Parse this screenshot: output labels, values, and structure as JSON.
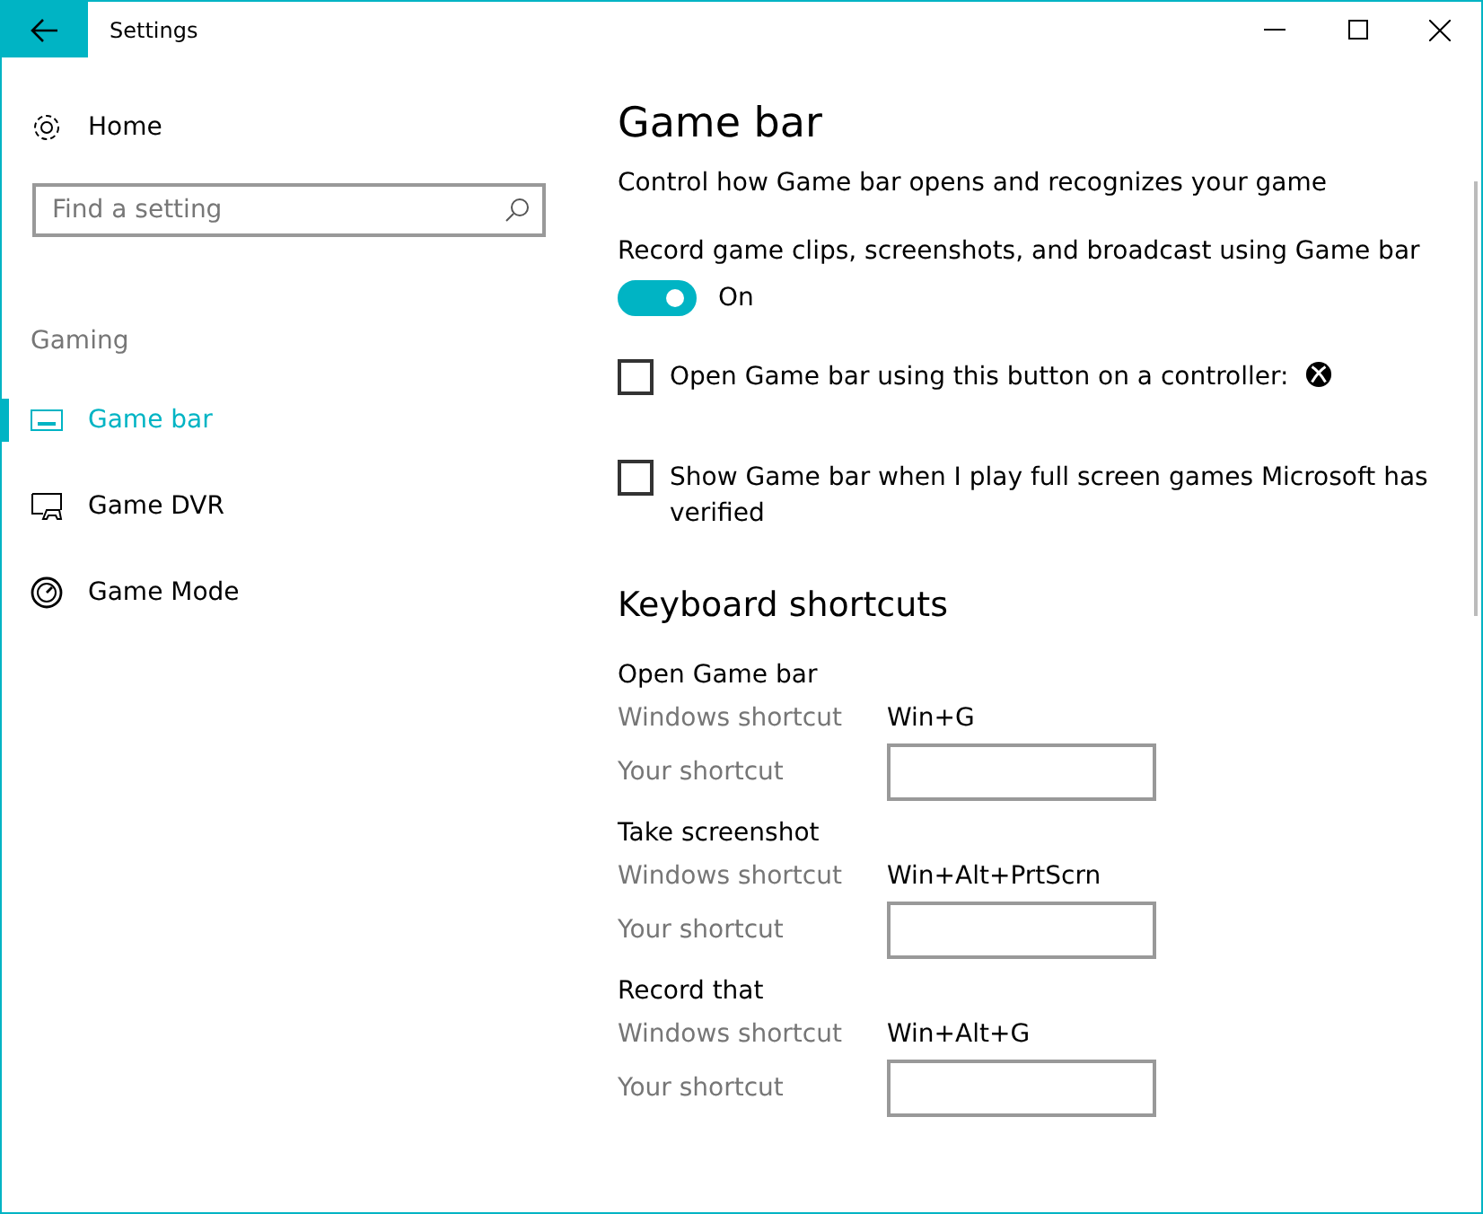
{
  "window": {
    "title": "Settings"
  },
  "sidebar": {
    "home": "Home",
    "search": {
      "placeholder": "Find a setting"
    },
    "section": "Gaming",
    "items": [
      {
        "label": "Game bar",
        "selected": true
      },
      {
        "label": "Game DVR",
        "selected": false
      },
      {
        "label": "Game Mode",
        "selected": false
      }
    ]
  },
  "page": {
    "title": "Game bar",
    "subtitle": "Control how Game bar opens and recognizes your game",
    "toggle": {
      "label": "Record game clips, screenshots, and broadcast using Game bar",
      "on": true,
      "state_text": "On"
    },
    "checkboxes": [
      {
        "label": "Open Game bar using this button on a controller:",
        "checked": false,
        "button_icon": true
      },
      {
        "label": "Show Game bar when I play full screen games Microsoft has verified",
        "checked": false,
        "button_icon": false
      }
    ],
    "shortcuts_title": "Keyboard shortcuts",
    "shortcuts": [
      {
        "name": "Open Game bar",
        "windows_label": "Windows shortcut",
        "windows_value": "Win+G",
        "yours_label": "Your shortcut"
      },
      {
        "name": "Take screenshot",
        "windows_label": "Windows shortcut",
        "windows_value": "Win+Alt+PrtScrn",
        "yours_label": "Your shortcut"
      },
      {
        "name": "Record that",
        "windows_label": "Windows shortcut",
        "windows_value": "Win+Alt+G",
        "yours_label": "Your shortcut"
      }
    ]
  }
}
